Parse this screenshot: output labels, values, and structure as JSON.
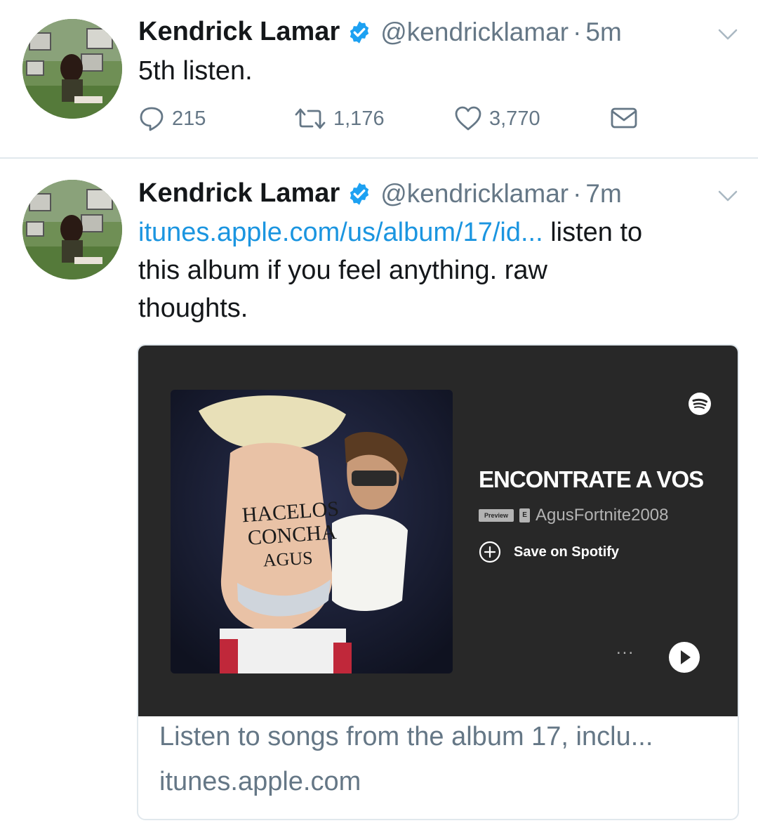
{
  "tweets": [
    {
      "author_name": "Kendrick Lamar",
      "handle": "@kendricklamar",
      "separator": "·",
      "time": "5m",
      "text": "5th listen.",
      "actions": {
        "replies": "215",
        "retweets": "1,176",
        "likes": "3,770"
      }
    },
    {
      "author_name": "Kendrick Lamar",
      "handle": "@kendricklamar",
      "separator": "·",
      "time": "7m",
      "link_text": "itunes.apple.com/us/album/17/id...",
      "text_line1_rest": " listen to",
      "text_line2": "this album if you feel anything. raw",
      "text_line3": "thoughts.",
      "card": {
        "cover_text": [
          "HACELOS",
          "CONCHA",
          "AGUS"
        ],
        "track_title": "ENCONTRATE A VOS",
        "preview_label": "Preview",
        "explicit_label": "E",
        "artist": "AgusFortnite2008",
        "save_label": "Save on Spotify",
        "more_label": "...",
        "description": "Listen to songs from the album 17, inclu...",
        "domain": "itunes.apple.com"
      }
    }
  ],
  "colors": {
    "link": "#1b95e0",
    "muted": "#657786",
    "verified": "#1da1f2",
    "player_bg": "#282828"
  },
  "icons": [
    "verified-badge-icon",
    "chevron-down-icon",
    "reply-icon",
    "retweet-icon",
    "like-icon",
    "dm-icon",
    "spotify-logo-icon",
    "add-circle-icon",
    "play-icon"
  ]
}
